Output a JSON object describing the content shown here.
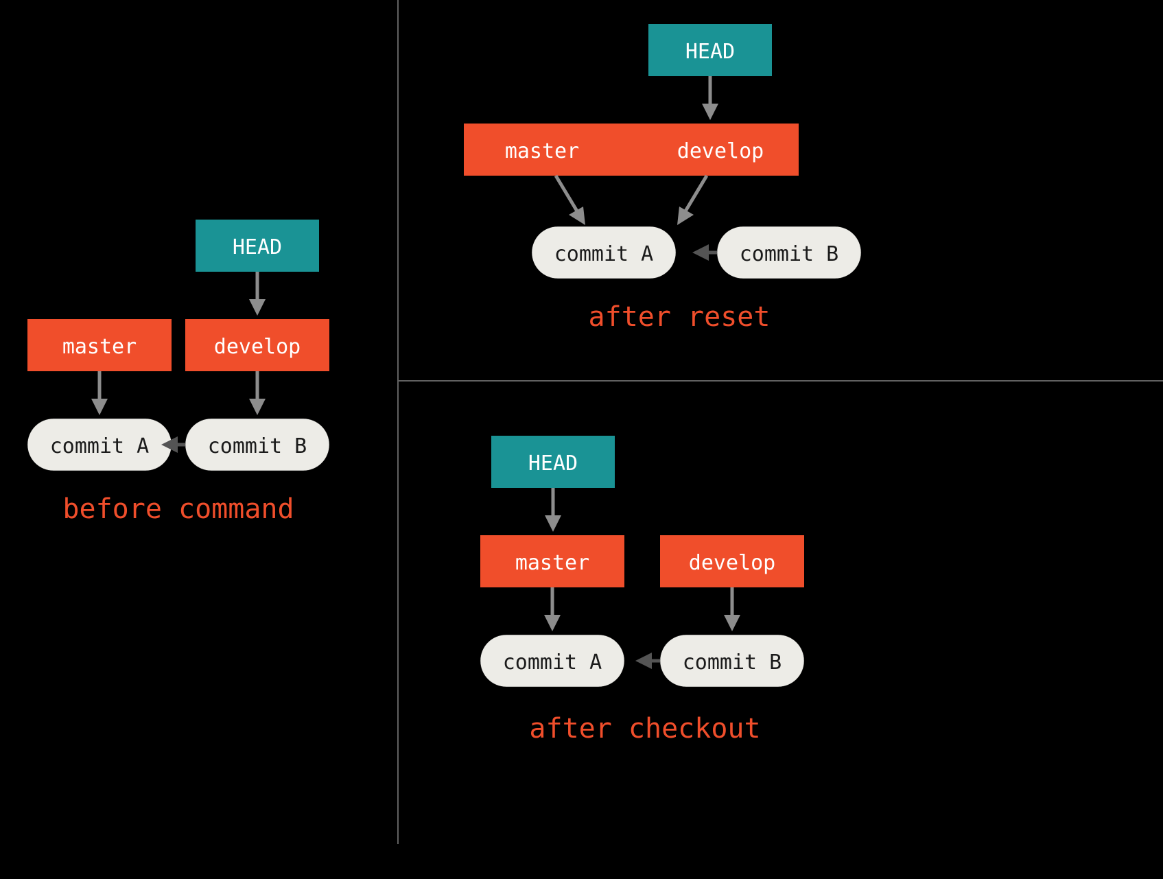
{
  "labels": {
    "head": "HEAD",
    "master": "master",
    "develop": "develop",
    "commit_a": "commit A",
    "commit_b": "commit B"
  },
  "captions": {
    "before": "before command",
    "reset": "after reset",
    "checkout": "after checkout"
  },
  "colors": {
    "head": "#1a9395",
    "branch": "#f04e2b",
    "commit": "#edece7",
    "caption": "#f04e2b",
    "arrow": "#8d8d8d",
    "divider": "#616161",
    "bg": "#000000"
  }
}
